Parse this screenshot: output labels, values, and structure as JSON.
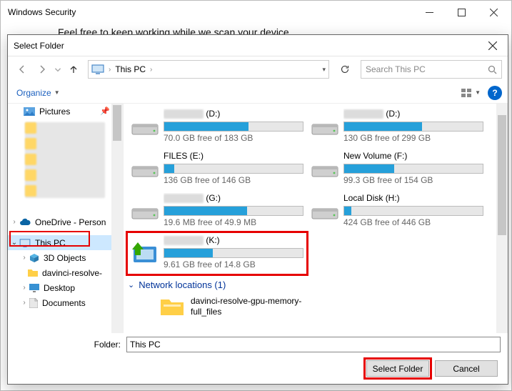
{
  "bg": {
    "title": "Windows Security",
    "message": "Feel free to keep working while we scan your device"
  },
  "dialog": {
    "title": "Select Folder",
    "breadcrumb": "This PC",
    "search_placeholder": "Search This PC",
    "organize": "Organize",
    "folder_label": "Folder:",
    "folder_value": "This PC",
    "select_btn": "Select Folder",
    "cancel_btn": "Cancel"
  },
  "sidebar": {
    "pictures": "Pictures",
    "onedrive": "OneDrive - Person",
    "thispc": "This PC",
    "obj3d": "3D Objects",
    "davinci": "davinci-resolve-",
    "desktop": "Desktop",
    "documents": "Documents"
  },
  "drives": [
    {
      "name": "(D:)",
      "free": "70.0 GB free of 183 GB",
      "fill": 61,
      "blurName": true
    },
    {
      "name": "(D:)",
      "free": "130 GB free of 299 GB",
      "fill": 56,
      "blurName": true
    },
    {
      "name": "FILES (E:)",
      "free": "136 GB free of 146 GB",
      "fill": 7,
      "blurName": false
    },
    {
      "name": "New Volume (F:)",
      "free": "99.3 GB free of 154 GB",
      "fill": 36,
      "blurName": false
    },
    {
      "name": "(G:)",
      "free": "19.6 MB free of 49.9 MB",
      "fill": 60,
      "blurName": true
    },
    {
      "name": "Local Disk (H:)",
      "free": "424 GB free of 446 GB",
      "fill": 5,
      "blurName": false
    },
    {
      "name": "(K:)",
      "free": "9.61 GB free of 14.8 GB",
      "fill": 35,
      "highlight": true,
      "blurName": true,
      "removable": true
    }
  ],
  "network": {
    "head": "Network locations (1)",
    "item": "davinci-resolve-gpu-memory-full_files"
  }
}
